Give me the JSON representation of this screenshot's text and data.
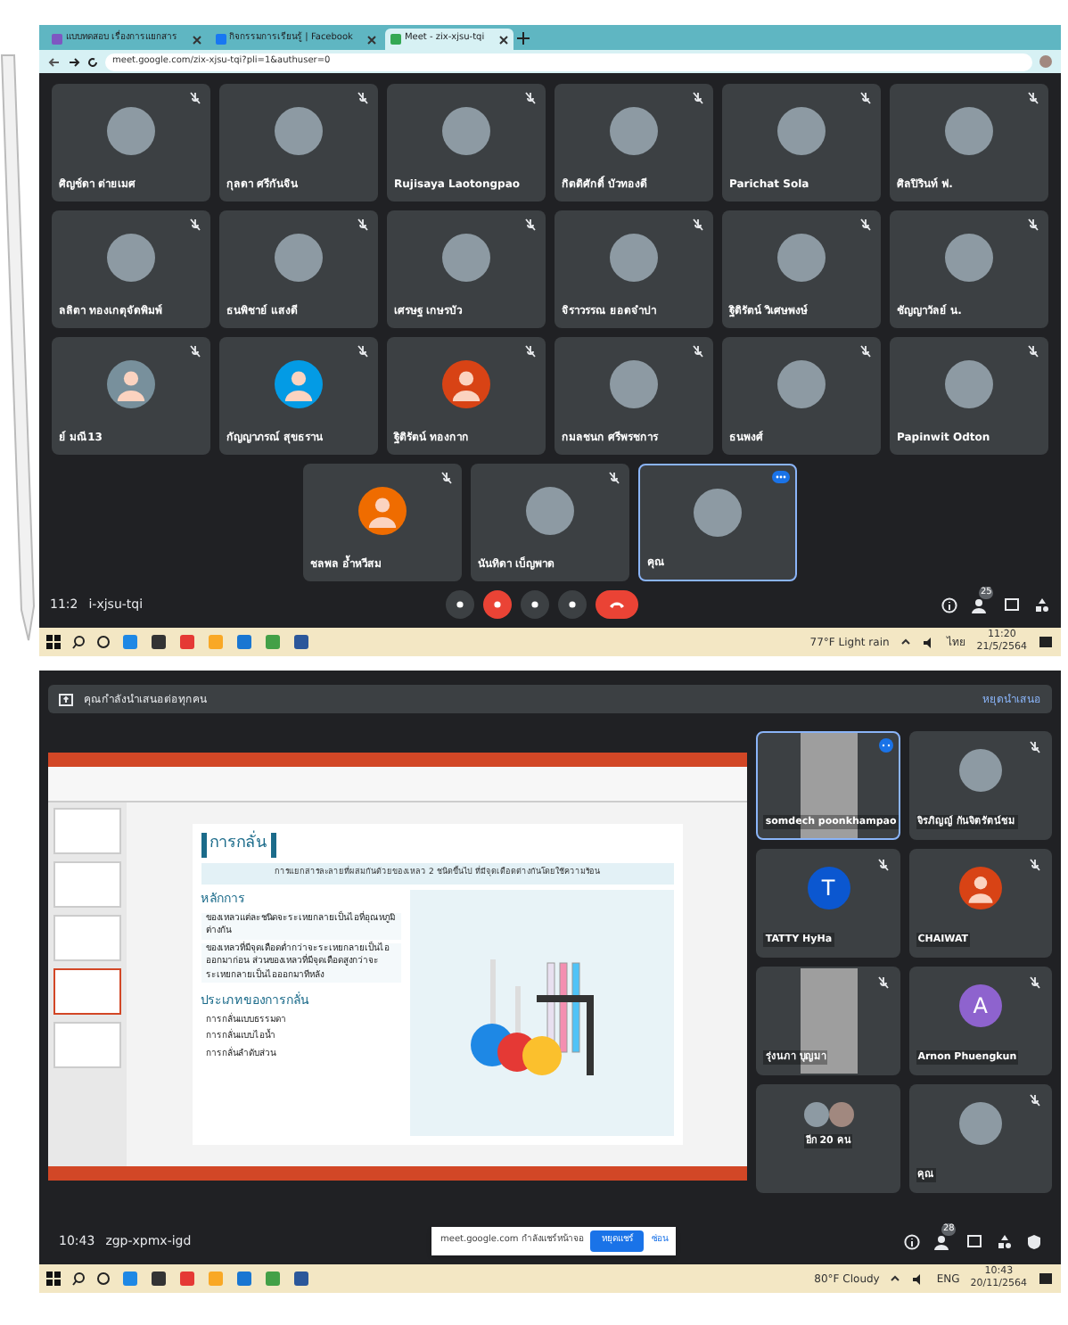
{
  "top_screen": {
    "browser_tabs": [
      {
        "title": "แบบทดสอบ เรื่องการแยกสาร",
        "selected": false
      },
      {
        "title": "กิจกรรมการเรียนรู้ | Facebook",
        "selected": false
      },
      {
        "title": "Meet - zix-xjsu-tqi",
        "selected": true
      }
    ],
    "address": "meet.google.com/zix-xjsu-tqi?pli=1&authuser=0",
    "tile_rows": [
      [
        {
          "name": "ศิญช์ดา ต่ายเมศ",
          "kind": "photo"
        },
        {
          "name": "กุลดา ศรีกันจิน",
          "kind": "photo"
        },
        {
          "name": "Rujisaya Laotongpao",
          "kind": "photo"
        },
        {
          "name": "กิตติศักดิ์ บัวทองดี",
          "kind": "photo"
        },
        {
          "name": "Parichat Sola",
          "kind": "photo"
        },
        {
          "name": "ศิลปิรินท์ ฟ.",
          "kind": "photo"
        }
      ],
      [
        {
          "name": "ลลิตา ทองเกตุจัดพิมพ์",
          "kind": "photo"
        },
        {
          "name": "ธนพิชาย์ แสงดี",
          "kind": "photo"
        },
        {
          "name": "เศรษฐ เกษรบัว",
          "kind": "photo"
        },
        {
          "name": "จิราวรรณ ยอดจำปา",
          "kind": "photo"
        },
        {
          "name": "ฐิติรัตน์ วิเศษพงษ์",
          "kind": "photo"
        },
        {
          "name": "ชัญญาวัลย์ น.",
          "kind": "photo"
        }
      ],
      [
        {
          "name": "ย์ มณี13",
          "kind": "avatar",
          "color": "#78909c"
        },
        {
          "name": "กัญญาภรณ์ สุขธราน",
          "kind": "avatar",
          "color": "#039be5"
        },
        {
          "name": "ฐิติรัตน์ ทองกาก",
          "kind": "avatar",
          "color": "#d84315"
        },
        {
          "name": "กมลชนก ศรีพรชการ",
          "kind": "photo"
        },
        {
          "name": "ธนพงศ์",
          "kind": "photo"
        },
        {
          "name": "Papinwit Odton",
          "kind": "photo"
        }
      ],
      [
        {
          "name": "ชลพล อ้ำหวีสม",
          "kind": "avatar",
          "color": "#ef6c00"
        },
        {
          "name": "นันทิดา เบ็ญพาด",
          "kind": "photo"
        },
        {
          "name": "คุณ",
          "kind": "self"
        }
      ]
    ],
    "meeting_time": "11:2",
    "meeting_code": "i-xjsu-tqi",
    "participant_count": "25",
    "taskbar": {
      "weather": "77°F Light rain",
      "language": "ไทย",
      "time": "11:20",
      "date": "21/5/2564"
    }
  },
  "bottom_screen": {
    "banner": "คุณกำลังนำเสนอต่อทุกคน",
    "stop_link": "หยุดนำเสนอ",
    "slide": {
      "title": "การกลั่น",
      "definition": "การแยกสารละลายที่ผสมกันด้วยของเหลว 2 ชนิดขึ้นไป ที่มีจุดเดือดต่างกันโดยใช้ความร้อน",
      "principle_heading": "หลักการ",
      "principles": [
        "ของเหลวแต่ละชนิดจะระเหยกลายเป็นไอที่อุณหภูมิต่างกัน",
        "ของเหลวที่มีจุดเดือดต่ำกว่าจะระเหยกลายเป็นไอออกมาก่อน ส่วนของเหลวที่มีจุดเดือดสูงกว่าจะระเหยกลายเป็นไอออกมาทีหลัง"
      ],
      "types_heading": "ประเภทของการกลั่น",
      "types": [
        "การกลั่นแบบธรรมดา",
        "การกลั่นแบบไอน้ำ",
        "การกลั่นลำดับส่วน"
      ]
    },
    "tiles": [
      {
        "name": "somdech poonkhampao",
        "kind": "video",
        "selected": true
      },
      {
        "name": "จิรภิญญ์ กันจิตรัตน์ชม",
        "kind": "photo",
        "selected": false
      },
      {
        "name": "TATTY HyHa",
        "kind": "letter",
        "letter": "T",
        "color": "#0b57d0",
        "selected": false
      },
      {
        "name": "CHAIWAT",
        "kind": "avatar",
        "color": "#d84315",
        "selected": false
      },
      {
        "name": "รุ่งนภา บุญมา",
        "kind": "video",
        "selected": false
      },
      {
        "name": "Arnon Phuengkun",
        "kind": "letter",
        "letter": "A",
        "color": "#8e63ce",
        "selected": false
      },
      {
        "name": "อีก 20 คน",
        "kind": "others",
        "selected": false
      },
      {
        "name": "คุณ",
        "kind": "photo",
        "selected": false
      }
    ],
    "meeting_time": "10:43",
    "meeting_code": "zgp-xpmx-igd",
    "participant_count": "28",
    "share_popup": {
      "message": "meet.google.com กำลังแชร์หน้าจอ",
      "stop_button": "หยุดแชร์",
      "hide_button": "ซ่อน"
    },
    "taskbar": {
      "weather": "80°F Cloudy",
      "language": "ENG",
      "time": "10:43",
      "date": "20/11/2564"
    }
  }
}
